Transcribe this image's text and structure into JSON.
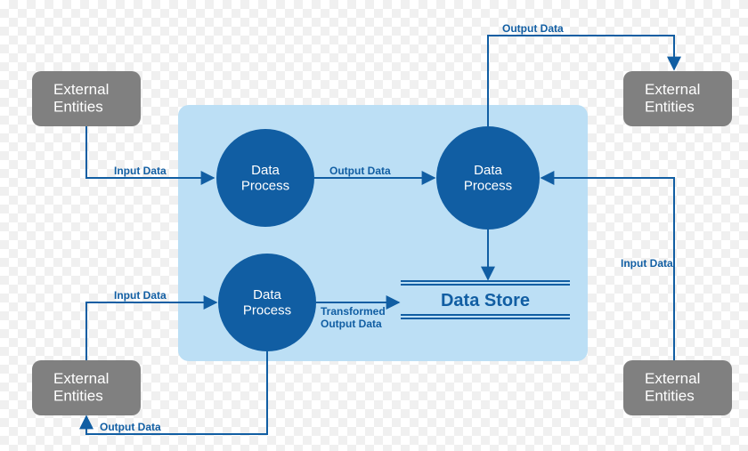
{
  "entities": {
    "top_left": "External\nEntities",
    "bottom_left": "External\nEntities",
    "top_right": "External\nEntities",
    "bottom_right": "External\nEntities"
  },
  "processes": {
    "p1": "Data\nProcess",
    "p2": "Data\nProcess",
    "p3": "Data\nProcess"
  },
  "store": {
    "label": "Data Store"
  },
  "flows": {
    "f1": "Input Data",
    "f2": "Output Data",
    "f3": "Input Data",
    "f4": "Transformed\nOutput Data",
    "f5": "Output Data",
    "f6": "Output Data",
    "f7": "Input Data"
  },
  "colors": {
    "process": "#115ea3",
    "container": "#bcdff5",
    "entity": "#808080",
    "arrow": "#115ea3"
  }
}
